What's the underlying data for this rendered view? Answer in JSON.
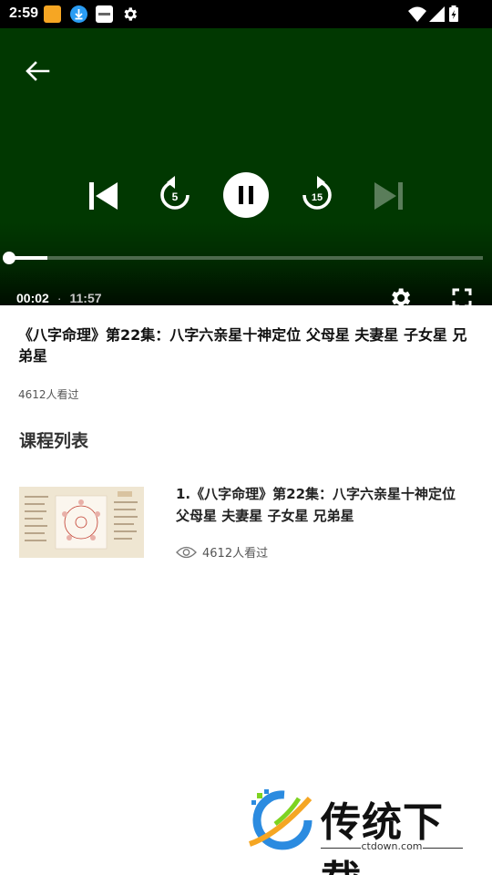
{
  "status_bar": {
    "time": "2:59",
    "icons": [
      "app-notification-icon",
      "download-icon",
      "app-icon",
      "settings-gear-icon",
      "wifi-icon",
      "signal-icon",
      "battery-charging-icon"
    ]
  },
  "player": {
    "rewind_seconds": "5",
    "forward_seconds": "15",
    "current_time": "00:02",
    "separator": "·",
    "total_time": "11:57",
    "progress": 0.08,
    "background_color": "#013801"
  },
  "video": {
    "title": "《八字命理》第22集：八字六亲星十神定位 父母星 夫妻星 子女星 兄弟星",
    "views": "4612人看过"
  },
  "course_list": {
    "heading": "课程列表",
    "items": [
      {
        "title": "1.《八字命理》第22集：八字六亲星十神定位 父母星 夫妻星 子女星 兄弟星",
        "views": "4612人看过"
      }
    ]
  },
  "watermark": {
    "brand": "传统下载",
    "url": "ctdown.com"
  }
}
